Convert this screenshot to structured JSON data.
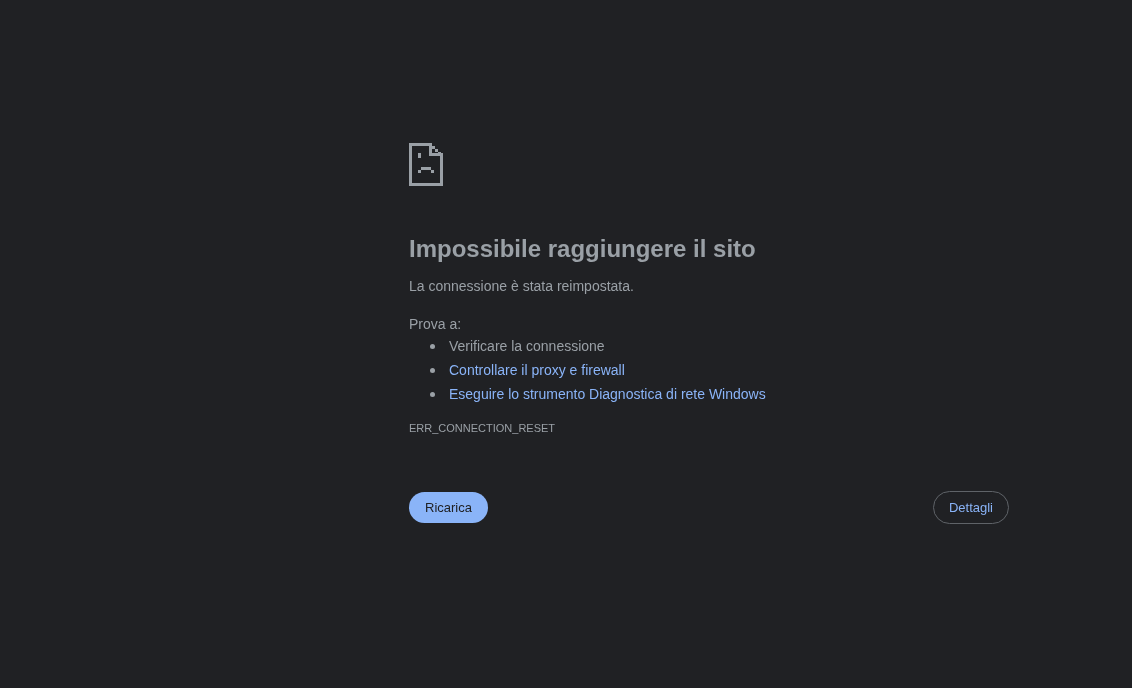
{
  "title": "Impossibile raggiungere il sito",
  "message": "La connessione è stata reimpostata.",
  "suggestions_heading": "Prova a:",
  "suggestions": [
    {
      "text": "Verificare la connessione",
      "kind": "text"
    },
    {
      "text": "Controllare il proxy e firewall",
      "kind": "link"
    },
    {
      "text": "Eseguire lo strumento Diagnostica di rete Windows",
      "kind": "link"
    }
  ],
  "error_code": "ERR_CONNECTION_RESET",
  "buttons": [
    {
      "label": "Ricarica",
      "kind": "primary"
    },
    {
      "label": "Dettagli",
      "kind": "outline"
    }
  ]
}
